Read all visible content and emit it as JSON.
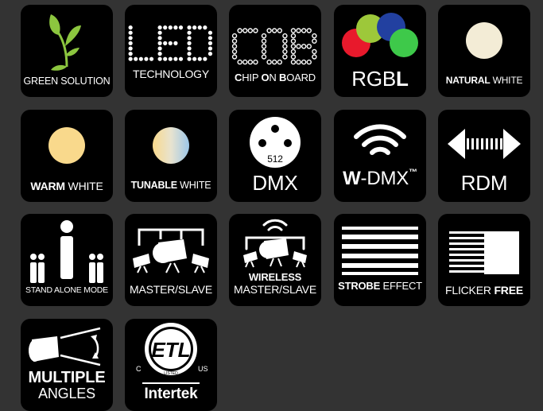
{
  "tiles": {
    "green_solution": {
      "line": "GREEN SOLUTION"
    },
    "led": {
      "title": "LED",
      "line": "TECHNOLOGY"
    },
    "cob": {
      "title": "COB",
      "c": "C",
      "hip": "HIP ",
      "o": "O",
      "n": "N ",
      "b": "B",
      "oard": "OARD"
    },
    "rgbl": {
      "rgb": "RGB",
      "l": "L"
    },
    "natural_white": {
      "bold": "NATURAL",
      "normal": " WHITE"
    },
    "warm_white": {
      "bold": "WARM",
      "normal": " WHITE"
    },
    "tunable_white": {
      "bold": "TUNABLE",
      "normal": " WHITE"
    },
    "dmx": {
      "pin": "512",
      "label": "DMX"
    },
    "wdmx": {
      "w": "W",
      "rest": "-DMX",
      "tm": "™"
    },
    "rdm": {
      "label": "RDM"
    },
    "stand_alone": {
      "line": "STAND ALONE MODE"
    },
    "master_slave": {
      "line": "MASTER/SLAVE"
    },
    "wireless_ms": {
      "bold": "WIRELESS",
      "line": "MASTER/SLAVE"
    },
    "strobe": {
      "bold": "STROBE",
      "normal": " EFFECT"
    },
    "flicker": {
      "normal": "FLICKER ",
      "bold": "FREE"
    },
    "multiple_angles": {
      "bold": "MULTIPLE",
      "normal": "ANGLES"
    },
    "etl": {
      "c": "C",
      "us": "US",
      "listed": "LISTED",
      "brand": "Intertek",
      "mark": "ETL"
    }
  },
  "colors": {
    "background": "#333333",
    "tile": "#000000",
    "red": "#e8192c",
    "green": "#3ec94a",
    "blue": "#2240a0",
    "lime": "#9dc83a",
    "natural": "#f3ecd6",
    "warm": "#f9d98c",
    "leaf": "#8cc63f"
  },
  "icons": [
    "sprout-icon",
    "led-dots-icon",
    "cob-dots-icon",
    "rgb-circles-icon",
    "natural-white-dot-icon",
    "warm-white-dot-icon",
    "tunable-white-dot-icon",
    "dmx-connector-icon",
    "wifi-icon",
    "double-arrow-icon",
    "people-icon",
    "spotlights-icon",
    "wireless-spotlights-icon",
    "strobe-lines-icon",
    "flicker-lines-icon",
    "angle-beam-icon",
    "etl-listed-icon"
  ]
}
